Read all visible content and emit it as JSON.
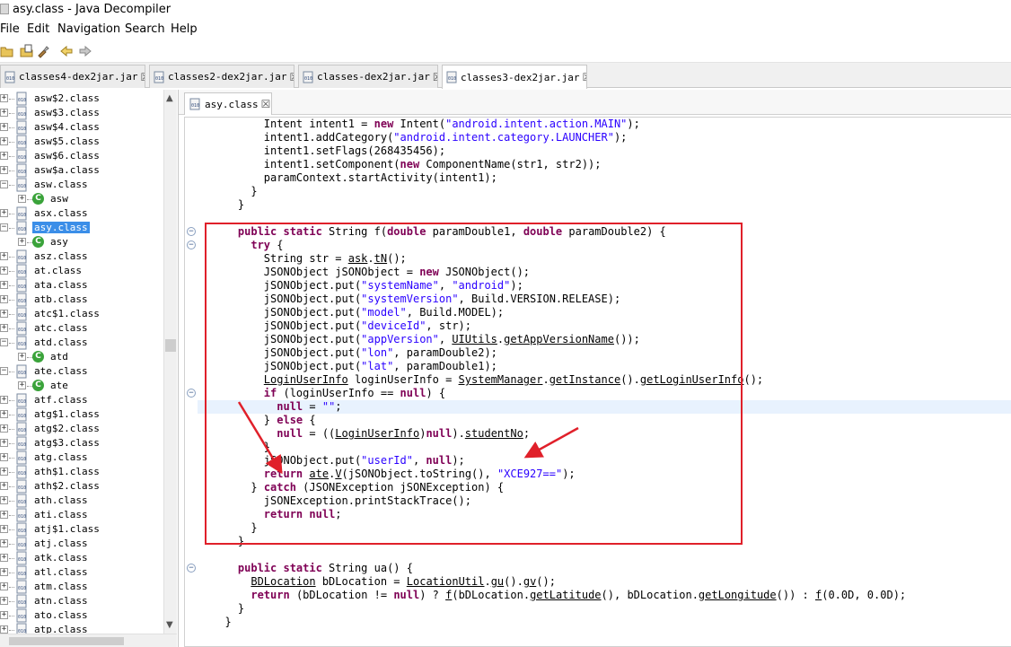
{
  "window": {
    "title": "asy.class - Java Decompiler"
  },
  "menu": [
    "File",
    "Edit",
    "Navigation",
    "Search",
    "Help"
  ],
  "toolbar": {
    "icons": [
      "open-folder-icon",
      "open-file-icon",
      "search-icon",
      "back-arrow-icon",
      "forward-arrow-icon"
    ]
  },
  "editor_tabs": [
    {
      "label": "classes4-dex2jar.jar",
      "close": "☒"
    },
    {
      "label": "classes2-dex2jar.jar",
      "close": "☒"
    },
    {
      "label": "classes-dex2jar.jar",
      "close": "☒"
    },
    {
      "label": "classes3-dex2jar.jar",
      "close": "☒"
    }
  ],
  "file_tab": {
    "label": "asy.class",
    "close": "☒"
  },
  "tree": {
    "items": [
      {
        "label": "asw$2.class",
        "type": "file",
        "toggle": "+"
      },
      {
        "label": "asw$3.class",
        "type": "file",
        "toggle": "+"
      },
      {
        "label": "asw$4.class",
        "type": "file",
        "toggle": "+"
      },
      {
        "label": "asw$5.class",
        "type": "file",
        "toggle": "+"
      },
      {
        "label": "asw$6.class",
        "type": "file",
        "toggle": "+"
      },
      {
        "label": "asw$a.class",
        "type": "file",
        "toggle": "+"
      },
      {
        "label": "asw.class",
        "type": "file",
        "toggle": "-"
      },
      {
        "label": "asw",
        "type": "class",
        "toggle": "+"
      },
      {
        "label": "asx.class",
        "type": "file",
        "toggle": "+"
      },
      {
        "label": "asy.class",
        "type": "file",
        "toggle": "-",
        "selected": true
      },
      {
        "label": "asy",
        "type": "class",
        "toggle": "+"
      },
      {
        "label": "asz.class",
        "type": "file",
        "toggle": "+"
      },
      {
        "label": "at.class",
        "type": "file",
        "toggle": "+"
      },
      {
        "label": "ata.class",
        "type": "file",
        "toggle": "+"
      },
      {
        "label": "atb.class",
        "type": "file",
        "toggle": "+"
      },
      {
        "label": "atc$1.class",
        "type": "file",
        "toggle": "+"
      },
      {
        "label": "atc.class",
        "type": "file",
        "toggle": "+"
      },
      {
        "label": "atd.class",
        "type": "file",
        "toggle": "-"
      },
      {
        "label": "atd",
        "type": "class",
        "toggle": "+"
      },
      {
        "label": "ate.class",
        "type": "file",
        "toggle": "-"
      },
      {
        "label": "ate",
        "type": "class",
        "toggle": "+"
      },
      {
        "label": "atf.class",
        "type": "file",
        "toggle": "+"
      },
      {
        "label": "atg$1.class",
        "type": "file",
        "toggle": "+"
      },
      {
        "label": "atg$2.class",
        "type": "file",
        "toggle": "+"
      },
      {
        "label": "atg$3.class",
        "type": "file",
        "toggle": "+"
      },
      {
        "label": "atg.class",
        "type": "file",
        "toggle": "+"
      },
      {
        "label": "ath$1.class",
        "type": "file",
        "toggle": "+"
      },
      {
        "label": "ath$2.class",
        "type": "file",
        "toggle": "+"
      },
      {
        "label": "ath.class",
        "type": "file",
        "toggle": "+"
      },
      {
        "label": "ati.class",
        "type": "file",
        "toggle": "+"
      },
      {
        "label": "atj$1.class",
        "type": "file",
        "toggle": "+"
      },
      {
        "label": "atj.class",
        "type": "file",
        "toggle": "+"
      },
      {
        "label": "atk.class",
        "type": "file",
        "toggle": "+"
      },
      {
        "label": "atl.class",
        "type": "file",
        "toggle": "+"
      },
      {
        "label": "atm.class",
        "type": "file",
        "toggle": "+"
      },
      {
        "label": "atn.class",
        "type": "file",
        "toggle": "+"
      },
      {
        "label": "ato.class",
        "type": "file",
        "toggle": "+"
      },
      {
        "label": "atp.class",
        "type": "file",
        "toggle": "+"
      }
    ]
  },
  "code": {
    "lines": [
      {
        "indent": 4,
        "tokens": [
          [
            "t",
            "Intent intent1 = "
          ],
          [
            "k",
            "new"
          ],
          [
            "t",
            " Intent("
          ],
          [
            "s",
            "\"android.intent.action.MAIN\""
          ],
          [
            "t",
            ");"
          ]
        ]
      },
      {
        "indent": 4,
        "tokens": [
          [
            "t",
            "intent1.addCategory("
          ],
          [
            "s",
            "\"android.intent.category.LAUNCHER\""
          ],
          [
            "t",
            ");"
          ]
        ]
      },
      {
        "indent": 4,
        "tokens": [
          [
            "t",
            "intent1.setFlags(268435456);"
          ]
        ]
      },
      {
        "indent": 4,
        "tokens": [
          [
            "t",
            "intent1.setComponent("
          ],
          [
            "k",
            "new"
          ],
          [
            "t",
            " ComponentName(str1, str2));"
          ]
        ]
      },
      {
        "indent": 4,
        "tokens": [
          [
            "t",
            "paramContext.startActivity(intent1);"
          ]
        ]
      },
      {
        "indent": 3,
        "tokens": [
          [
            "t",
            "}"
          ]
        ]
      },
      {
        "indent": 2,
        "tokens": [
          [
            "t",
            "}"
          ]
        ]
      },
      {
        "indent": 0,
        "tokens": []
      },
      {
        "indent": 2,
        "fold": "-",
        "tokens": [
          [
            "k",
            "public static"
          ],
          [
            "t",
            " String f("
          ],
          [
            "k",
            "double"
          ],
          [
            "t",
            " paramDouble1, "
          ],
          [
            "k",
            "double"
          ],
          [
            "t",
            " paramDouble2) {"
          ]
        ]
      },
      {
        "indent": 3,
        "fold": "-",
        "tokens": [
          [
            "k",
            "try"
          ],
          [
            "t",
            " {"
          ]
        ]
      },
      {
        "indent": 4,
        "tokens": [
          [
            "t",
            "String str = "
          ],
          [
            "u",
            "ask"
          ],
          [
            "t",
            "."
          ],
          [
            "u",
            "tN"
          ],
          [
            "t",
            "();"
          ]
        ]
      },
      {
        "indent": 4,
        "tokens": [
          [
            "t",
            "JSONObject jSONObject = "
          ],
          [
            "k",
            "new"
          ],
          [
            "t",
            " JSONObject();"
          ]
        ]
      },
      {
        "indent": 4,
        "tokens": [
          [
            "t",
            "jSONObject.put("
          ],
          [
            "s",
            "\"systemName\""
          ],
          [
            "t",
            ", "
          ],
          [
            "s",
            "\"android\""
          ],
          [
            "t",
            ");"
          ]
        ]
      },
      {
        "indent": 4,
        "tokens": [
          [
            "t",
            "jSONObject.put("
          ],
          [
            "s",
            "\"systemVersion\""
          ],
          [
            "t",
            ", Build.VERSION.RELEASE);"
          ]
        ]
      },
      {
        "indent": 4,
        "tokens": [
          [
            "t",
            "jSONObject.put("
          ],
          [
            "s",
            "\"model\""
          ],
          [
            "t",
            ", Build.MODEL);"
          ]
        ]
      },
      {
        "indent": 4,
        "tokens": [
          [
            "t",
            "jSONObject.put("
          ],
          [
            "s",
            "\"deviceId\""
          ],
          [
            "t",
            ", str);"
          ]
        ]
      },
      {
        "indent": 4,
        "tokens": [
          [
            "t",
            "jSONObject.put("
          ],
          [
            "s",
            "\"appVersion\""
          ],
          [
            "t",
            ", "
          ],
          [
            "u",
            "UIUtils"
          ],
          [
            "t",
            "."
          ],
          [
            "u",
            "getAppVersionName"
          ],
          [
            "t",
            "());"
          ]
        ]
      },
      {
        "indent": 4,
        "tokens": [
          [
            "t",
            "jSONObject.put("
          ],
          [
            "s",
            "\"lon\""
          ],
          [
            "t",
            ", paramDouble2);"
          ]
        ]
      },
      {
        "indent": 4,
        "tokens": [
          [
            "t",
            "jSONObject.put("
          ],
          [
            "s",
            "\"lat\""
          ],
          [
            "t",
            ", paramDouble1);"
          ]
        ]
      },
      {
        "indent": 4,
        "tokens": [
          [
            "u",
            "LoginUserInfo"
          ],
          [
            "t",
            " loginUserInfo = "
          ],
          [
            "u",
            "SystemManager"
          ],
          [
            "t",
            "."
          ],
          [
            "u",
            "getInstance"
          ],
          [
            "t",
            "()."
          ],
          [
            "u",
            "getLoginUserInfo"
          ],
          [
            "t",
            "();"
          ]
        ]
      },
      {
        "indent": 4,
        "fold": "-",
        "tokens": [
          [
            "k",
            "if"
          ],
          [
            "t",
            " (loginUserInfo == "
          ],
          [
            "k",
            "null"
          ],
          [
            "t",
            ") {"
          ]
        ]
      },
      {
        "indent": 5,
        "highlight": true,
        "tokens": [
          [
            "k",
            "null"
          ],
          [
            "t",
            " = "
          ],
          [
            "s",
            "\"\""
          ],
          [
            "t",
            ";"
          ]
        ]
      },
      {
        "indent": 4,
        "tokens": [
          [
            "t",
            "} "
          ],
          [
            "k",
            "else"
          ],
          [
            "t",
            " {"
          ]
        ]
      },
      {
        "indent": 5,
        "tokens": [
          [
            "k",
            "null"
          ],
          [
            "t",
            " = (("
          ],
          [
            "u",
            "LoginUserInfo"
          ],
          [
            "t",
            ")"
          ],
          [
            "k",
            "null"
          ],
          [
            "t",
            ")."
          ],
          [
            "u",
            "studentNo"
          ],
          [
            "t",
            ";"
          ]
        ]
      },
      {
        "indent": 4,
        "tokens": [
          [
            "t",
            "}"
          ]
        ]
      },
      {
        "indent": 4,
        "tokens": [
          [
            "t",
            "jSONObject.put("
          ],
          [
            "s",
            "\"userId\""
          ],
          [
            "t",
            ", "
          ],
          [
            "k",
            "null"
          ],
          [
            "t",
            ");"
          ]
        ]
      },
      {
        "indent": 4,
        "tokens": [
          [
            "k",
            "return"
          ],
          [
            "t",
            " "
          ],
          [
            "u",
            "ate"
          ],
          [
            "t",
            "."
          ],
          [
            "u",
            "V"
          ],
          [
            "t",
            "(jSONObject.toString(), "
          ],
          [
            "s",
            "\"XCE927==\""
          ],
          [
            "t",
            ");"
          ]
        ]
      },
      {
        "indent": 3,
        "tokens": [
          [
            "t",
            "} "
          ],
          [
            "k",
            "catch"
          ],
          [
            "t",
            " (JSONException jSONException) {"
          ]
        ]
      },
      {
        "indent": 4,
        "tokens": [
          [
            "t",
            "jSONException.printStackTrace();"
          ]
        ]
      },
      {
        "indent": 4,
        "tokens": [
          [
            "k",
            "return"
          ],
          [
            "t",
            " "
          ],
          [
            "k",
            "null"
          ],
          [
            "t",
            ";"
          ]
        ]
      },
      {
        "indent": 3,
        "tokens": [
          [
            "t",
            "}"
          ]
        ]
      },
      {
        "indent": 2,
        "tokens": [
          [
            "t",
            "}"
          ]
        ]
      },
      {
        "indent": 0,
        "tokens": []
      },
      {
        "indent": 2,
        "fold": "-",
        "tokens": [
          [
            "k",
            "public static"
          ],
          [
            "t",
            " String ua() {"
          ]
        ]
      },
      {
        "indent": 3,
        "tokens": [
          [
            "u",
            "BDLocation"
          ],
          [
            "t",
            " bDLocation = "
          ],
          [
            "u",
            "LocationUtil"
          ],
          [
            "t",
            "."
          ],
          [
            "u",
            "gu"
          ],
          [
            "t",
            "()."
          ],
          [
            "u",
            "gv"
          ],
          [
            "t",
            "();"
          ]
        ]
      },
      {
        "indent": 3,
        "tokens": [
          [
            "k",
            "return"
          ],
          [
            "t",
            " (bDLocation != "
          ],
          [
            "k",
            "null"
          ],
          [
            "t",
            ") ? "
          ],
          [
            "u",
            "f"
          ],
          [
            "t",
            "(bDLocation."
          ],
          [
            "u",
            "getLatitude"
          ],
          [
            "t",
            "(), bDLocation."
          ],
          [
            "u",
            "getLongitude"
          ],
          [
            "t",
            "()) : "
          ],
          [
            "u",
            "f"
          ],
          [
            "t",
            "(0.0D, 0.0D);"
          ]
        ]
      },
      {
        "indent": 2,
        "tokens": [
          [
            "t",
            "}"
          ]
        ]
      },
      {
        "indent": 1,
        "tokens": [
          [
            "t",
            "}"
          ]
        ]
      }
    ]
  },
  "colors": {
    "keyword": "#7f0055",
    "string": "#2a00ff",
    "selection": "#3b8ee8",
    "annotation": "#e0202a",
    "line_highlight": "#e8f2fe"
  }
}
